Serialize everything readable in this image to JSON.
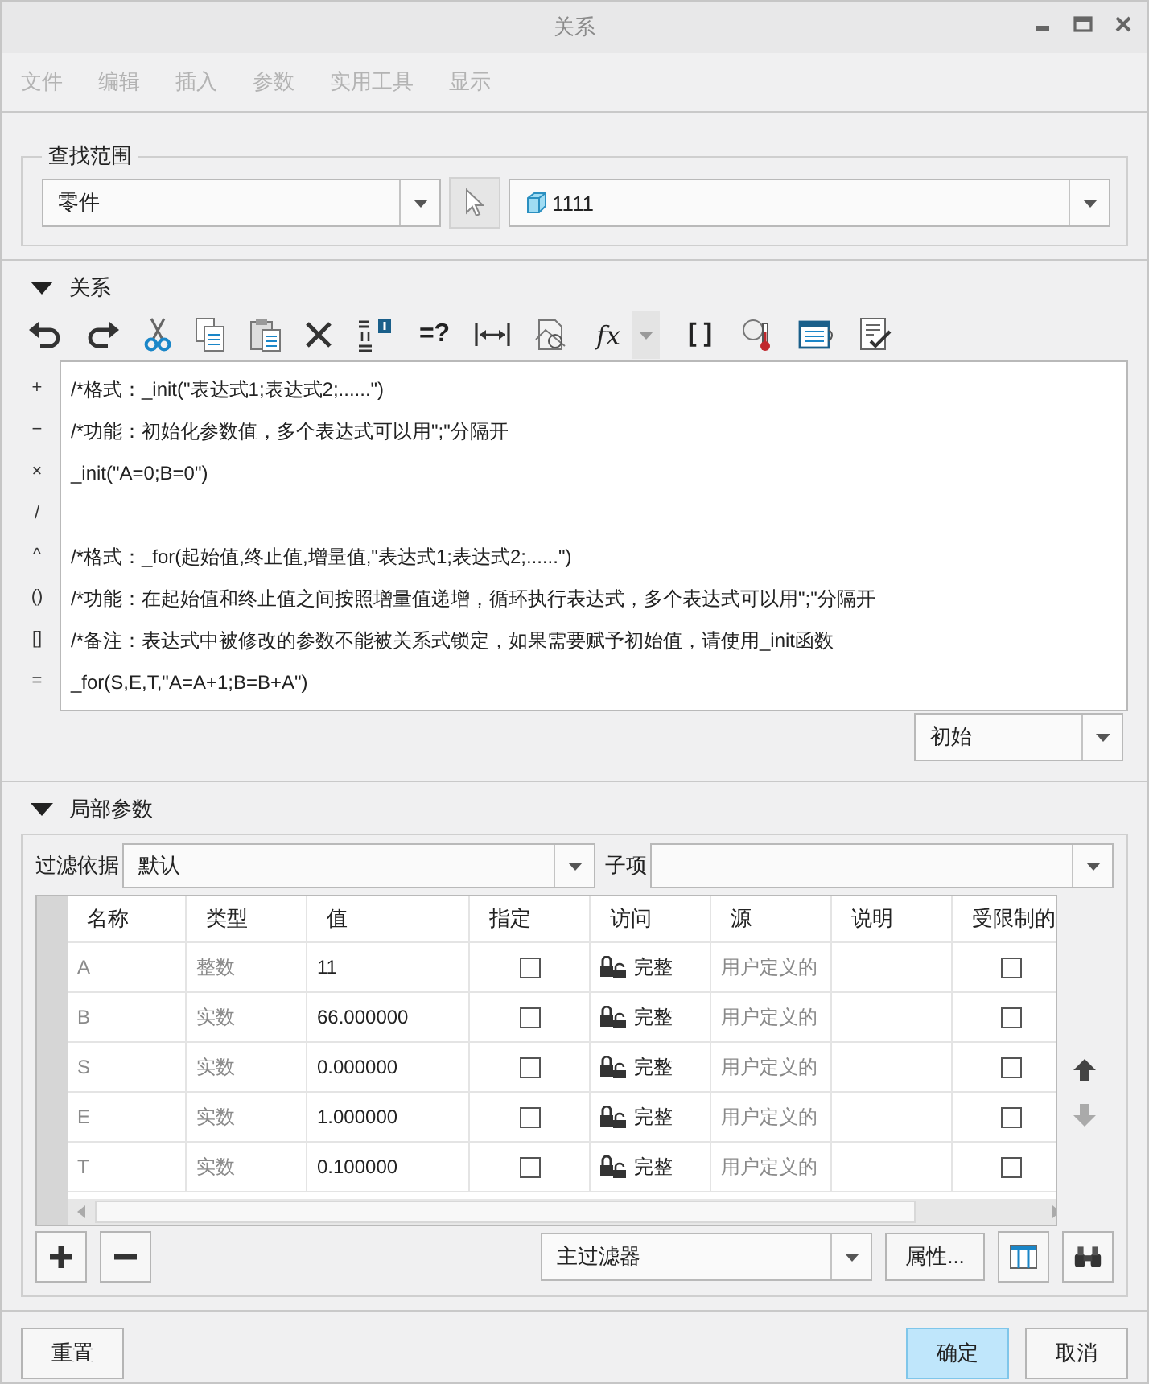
{
  "window": {
    "title": "关系"
  },
  "menu": [
    {
      "label": "文件",
      "disabled": true
    },
    {
      "label": "编辑",
      "disabled": true
    },
    {
      "label": "插入",
      "disabled": true
    },
    {
      "label": "参数",
      "disabled": true
    },
    {
      "label": "实用工具",
      "disabled": true
    },
    {
      "label": "显示",
      "disabled": true
    }
  ],
  "lookup": {
    "title": "查找范围",
    "scope": "零件",
    "model": "1111"
  },
  "relations": {
    "title": "关系",
    "expanded": true,
    "toolbar": [
      {
        "kind": "undo"
      },
      {
        "kind": "redo"
      },
      {
        "kind": "cut"
      },
      {
        "kind": "copy"
      },
      {
        "kind": "paste"
      },
      {
        "kind": "delete"
      },
      {
        "kind": "swap"
      },
      {
        "kind": "text",
        "label": "=?"
      },
      {
        "kind": "measure"
      },
      {
        "kind": "analysis"
      },
      {
        "kind": "text",
        "label": "fx"
      },
      {
        "kind": "menu"
      },
      {
        "kind": "text",
        "label": "[ ]"
      },
      {
        "kind": "thermo"
      },
      {
        "kind": "list"
      },
      {
        "kind": "check"
      }
    ],
    "operators": [
      "+",
      "−",
      "×",
      "/",
      "^",
      "()",
      "[]",
      "="
    ],
    "blocks": [
      [
        "/*格式：_init(\"表达式1;表达式2;......\")",
        "/*功能：初始化参数值，多个表达式可以用\";\"分隔开",
        "_init(\"A=0;B=0\")"
      ],
      [
        "/*格式：_for(起始值,终止值,增量值,\"表达式1;表达式2;......\")",
        "/*功能：在起始值和终止值之间按照增量值递增，循环执行表达式，多个表达式可以用\";\"分隔开",
        "/*备注：表达式中被修改的参数不能被关系式锁定，如果需要赋予初始值，请使用_init函数",
        "_for(S,E,T,\"A=A+1;B=B+A\")"
      ]
    ],
    "stage": "初始"
  },
  "parameters": {
    "title": "局部参数",
    "expanded": true,
    "filter_label": "过滤依据",
    "filter": "默认",
    "child_label": "子项",
    "columns": [
      "名称",
      "类型",
      "值",
      "指定",
      "访问",
      "源",
      "说明",
      "受限制的"
    ],
    "rows": [
      {
        "name": "A",
        "type": "整数",
        "value": "11",
        "designated": false,
        "access": "完整",
        "source": "用户定义的",
        "restricted": false
      },
      {
        "name": "B",
        "type": "实数",
        "value": "66.000000",
        "designated": false,
        "access": "完整",
        "source": "用户定义的",
        "restricted": false
      },
      {
        "name": "S",
        "type": "实数",
        "value": "0.000000",
        "designated": false,
        "access": "完整",
        "source": "用户定义的",
        "restricted": false
      },
      {
        "name": "E",
        "type": "实数",
        "value": "1.000000",
        "designated": false,
        "access": "完整",
        "source": "用户定义的",
        "restricted": false
      },
      {
        "name": "T",
        "type": "实数",
        "value": "0.100000",
        "designated": false,
        "access": "完整",
        "source": "用户定义的",
        "restricted": false
      }
    ],
    "main_filter": "主过滤器",
    "properties_button": "属性..."
  },
  "buttons": [
    {
      "label": "重置",
      "default": false
    },
    {
      "label": "确定",
      "default": true
    },
    {
      "label": "取消",
      "default": false
    }
  ]
}
